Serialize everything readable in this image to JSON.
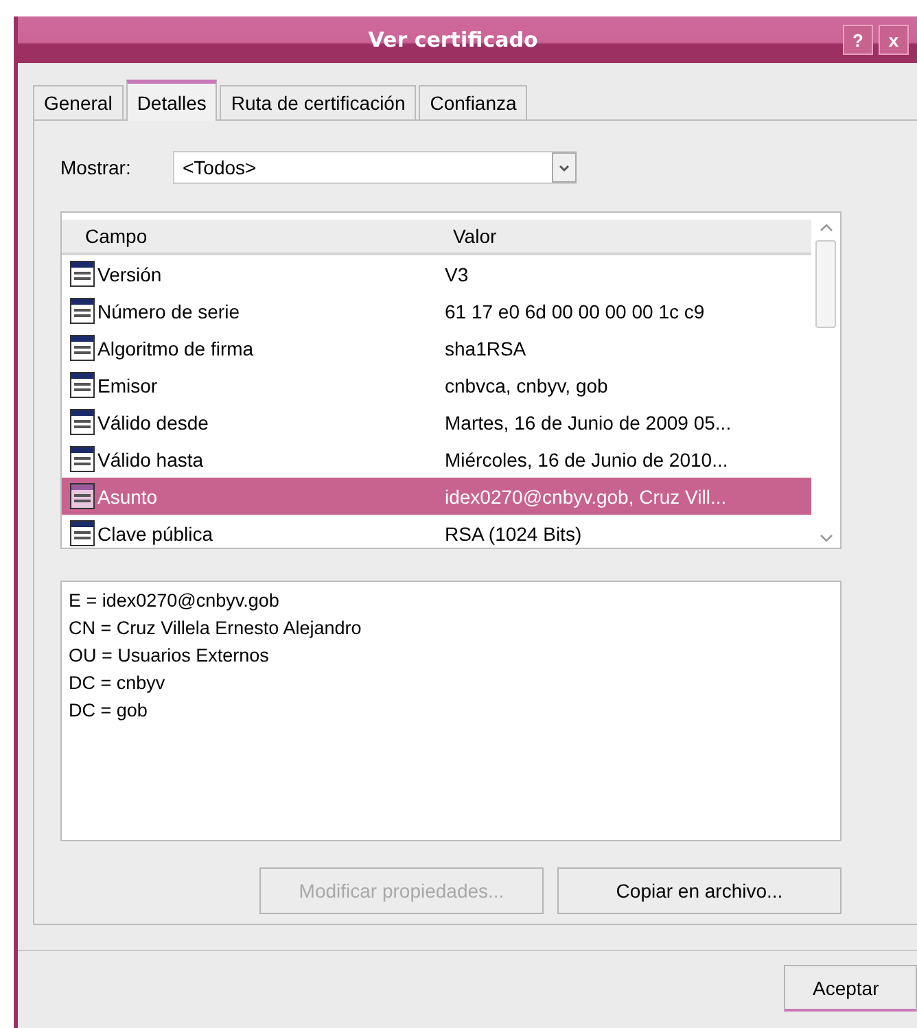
{
  "window": {
    "title": "Ver certificado",
    "help": "?",
    "close": "x"
  },
  "tabs": [
    {
      "label": "General",
      "selected": false
    },
    {
      "label": "Detalles",
      "selected": true
    },
    {
      "label": "Ruta de certificación",
      "selected": false
    },
    {
      "label": "Confianza",
      "selected": false
    }
  ],
  "show": {
    "label": "Mostrar:",
    "value": "<Todos>"
  },
  "table": {
    "columns": [
      "Campo",
      "Valor"
    ],
    "rows": [
      {
        "field": "Versión",
        "value": "V3",
        "selected": false
      },
      {
        "field": "Número de serie",
        "value": "61 17 e0 6d 00 00 00 00 1c c9",
        "selected": false
      },
      {
        "field": "Algoritmo de firma",
        "value": "sha1RSA",
        "selected": false
      },
      {
        "field": "Emisor",
        "value": "cnbvca, cnbyv, gob",
        "selected": false
      },
      {
        "field": "Válido desde",
        "value": "Martes, 16 de Junio de 2009 05...",
        "selected": false
      },
      {
        "field": "Válido hasta",
        "value": "Miércoles, 16 de Junio de 2010...",
        "selected": false
      },
      {
        "field": "Asunto",
        "value": "idex0270@cnbyv.gob, Cruz Vill...",
        "selected": true
      },
      {
        "field": "Clave pública",
        "value": "RSA (1024 Bits)",
        "selected": false
      }
    ]
  },
  "details": [
    "E = idex0270@cnbyv.gob",
    "CN = Cruz Villela Ernesto Alejandro",
    "OU = Usuarios Externos",
    "DC = cnbyv",
    "DC = gob"
  ],
  "buttons": [
    {
      "label": "Modificar propiedades...",
      "disabled": true
    },
    {
      "label": "Copiar en archivo...",
      "disabled": false
    }
  ],
  "ok": "Aceptar"
}
